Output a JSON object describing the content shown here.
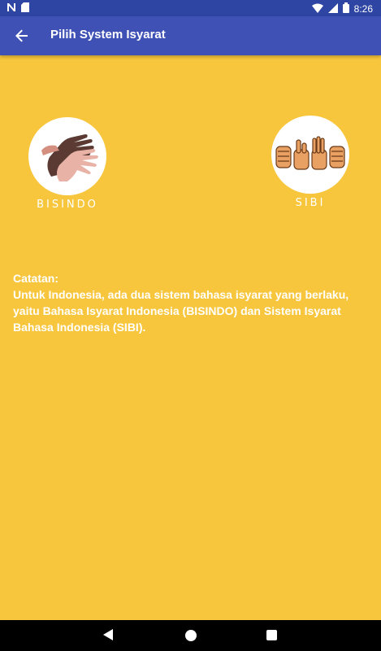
{
  "status_bar": {
    "left_icons": [
      "n-notification-icon",
      "sd-card-icon"
    ],
    "right_icons": [
      "wifi-icon",
      "signal-icon",
      "battery-icon"
    ],
    "time": "8:26"
  },
  "app_bar": {
    "title": "Pilih System Isyarat",
    "back_icon": "arrow-left-icon",
    "background_color": "#3F51B5"
  },
  "options": {
    "bisindo": {
      "label": "BISINDO",
      "icon": "bisindo-hands-icon"
    },
    "sibi": {
      "label": "SIBI",
      "icon": "sibi-hands-icon"
    }
  },
  "note": {
    "heading": "Catatan:",
    "body": "Untuk Indonesia, ada dua sistem bahasa isyarat yang berlaku, yaitu Bahasa Isyarat Indonesia (BISINDO) dan Sistem Isyarat Bahasa Indonesia (SIBI)."
  },
  "nav_bar": {
    "icons": [
      "back-triangle-icon",
      "home-circle-icon",
      "recents-square-icon"
    ]
  },
  "colors": {
    "background": "#F7C63C",
    "status_bar": "#2F45A3",
    "text": "#FFFFFF"
  }
}
